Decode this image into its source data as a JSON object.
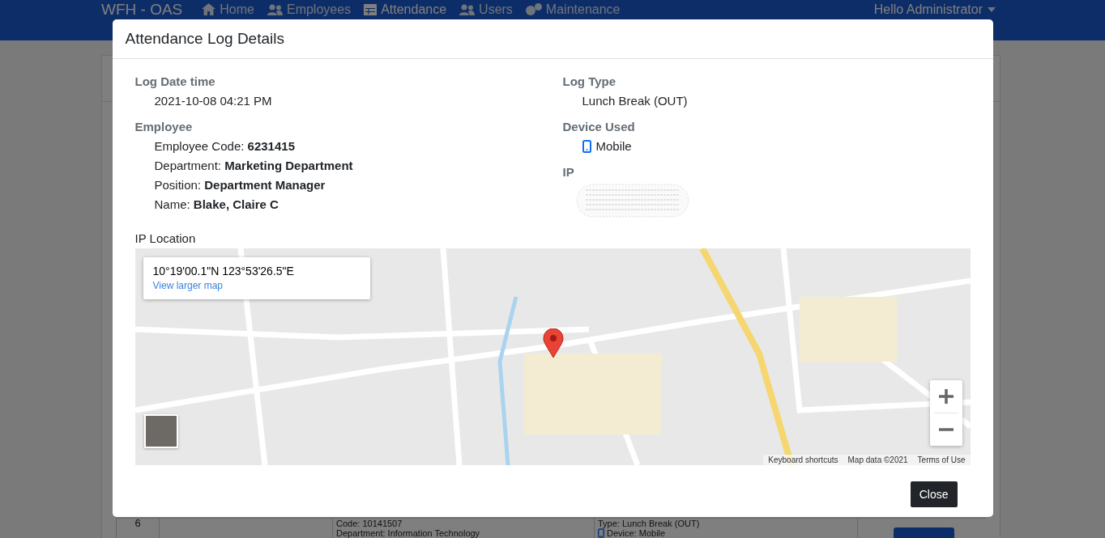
{
  "navbar": {
    "brand": "WFH - OAS",
    "items": [
      {
        "label": "Home",
        "selected": false
      },
      {
        "label": "Employees",
        "selected": false
      },
      {
        "label": "Attendance",
        "selected": true
      },
      {
        "label": "Users",
        "selected": false
      },
      {
        "label": "Maintenance",
        "selected": false
      }
    ],
    "user_menu": "Hello Administrator"
  },
  "background_table": {
    "rows": [
      {
        "number": "6",
        "employee_lines": [
          "Code: 10141507",
          "Department: Information Technology"
        ],
        "log_lines": [
          "Type: Lunch Break (OUT)",
          "Device: Mobile"
        ]
      }
    ]
  },
  "modal": {
    "title": "Attendance Log Details",
    "log_datetime": {
      "label": "Log Date time",
      "value": "2021-10-08 04:21 PM"
    },
    "employee": {
      "label": "Employee",
      "fields": [
        "Employee Code: **6231415**",
        "Department: **Marketing Department**",
        "Position: **Department Manager**",
        "Name: **Blake, Claire C**"
      ]
    },
    "log_type": {
      "label": "Log Type",
      "value": "Lunch Break (OUT)"
    },
    "device": {
      "label": "Device Used",
      "value": "Mobile"
    },
    "ip": {
      "label": "IP",
      "redacted": true
    },
    "ip_location": {
      "label": "IP Location",
      "map": {
        "coordinates": "10°19'00.1\"N 123°53'26.5\"E",
        "link": "View larger map",
        "footer_links": [
          "Keyboard shortcuts",
          "Map data ©2021",
          "Terms of Use"
        ]
      }
    },
    "buttons": [
      "Close"
    ]
  }
}
